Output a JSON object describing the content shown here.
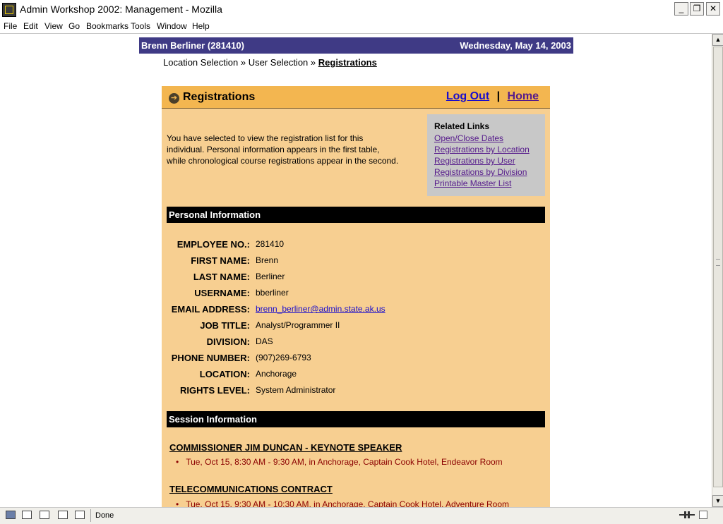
{
  "window": {
    "title": "Admin Workshop 2002: Management - Mozilla",
    "min_symbol": "_",
    "max_symbol": "❐",
    "close_symbol": "✕"
  },
  "menu": [
    "File",
    "Edit",
    "View",
    "Go",
    "Bookmarks",
    "Tools",
    "Window",
    "Help"
  ],
  "userbar": {
    "name": "Brenn Berliner (281410)",
    "date": "Wednesday, May 14, 2003"
  },
  "breadcrumb": {
    "item1": "Location Selection",
    "sep": "»",
    "item2": "User Selection",
    "current": "Registrations"
  },
  "panel": {
    "title": "Registrations",
    "logout": "Log Out",
    "separator": "|",
    "home": "Home",
    "intro": "You have selected to view the registration list for this individual. Personal information appears in the first table, while chronological course registrations appear in the second."
  },
  "related": {
    "title": "Related Links",
    "links": [
      "Open/Close Dates",
      "Registrations by Location",
      "Registrations by User",
      "Registrations by Division",
      "Printable Master List"
    ]
  },
  "personal": {
    "heading": "Personal Information",
    "rows": [
      {
        "label": "EMPLOYEE NO.:",
        "value": "281410"
      },
      {
        "label": "FIRST NAME:",
        "value": "Brenn"
      },
      {
        "label": "LAST NAME:",
        "value": "Berliner"
      },
      {
        "label": "USERNAME:",
        "value": "bberliner"
      },
      {
        "label": "EMAIL ADDRESS:",
        "value": "brenn_berliner@admin.state.ak.us"
      },
      {
        "label": "JOB TITLE:",
        "value": "Analyst/Programmer II"
      },
      {
        "label": "DIVISION:",
        "value": "DAS"
      },
      {
        "label": "PHONE NUMBER:",
        "value": "(907)269-6793"
      },
      {
        "label": "LOCATION:",
        "value": "Anchorage"
      },
      {
        "label": "RIGHTS LEVEL:",
        "value": "System Administrator"
      }
    ]
  },
  "sessions": {
    "heading": "Session Information",
    "items": [
      {
        "title": "COMMISSIONER JIM DUNCAN - KEYNOTE SPEAKER",
        "detail": "Tue, Oct 15, 8:30 AM - 9:30 AM, in Anchorage, Captain Cook Hotel, Endeavor Room"
      },
      {
        "title": "TELECOMMUNICATIONS CONTRACT",
        "detail": "Tue, Oct 15, 9:30 AM - 10:30 AM, in Anchorage, Captain Cook Hotel, Adventure Room"
      }
    ]
  },
  "status": {
    "text": "Done"
  },
  "colors": {
    "userbar": "#3f3a85",
    "panel": "#f7cf91",
    "panel_header": "#f3b650",
    "section_bar": "#000000",
    "session_detail": "#8b0000"
  }
}
